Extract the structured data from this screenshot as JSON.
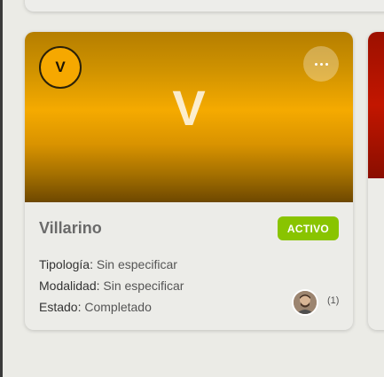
{
  "card": {
    "initial": "V",
    "banner_letter": "V",
    "name": "Villarino",
    "status": "ACTIVO",
    "fields": [
      {
        "label": "Tipología:",
        "value": "Sin especificar"
      },
      {
        "label": "Modalidad:",
        "value": "Sin especificar"
      },
      {
        "label": "Estado:",
        "value": "Completado"
      }
    ],
    "members_count": "(1)",
    "icons": {
      "menu": "more-horizontal-icon",
      "avatar": "user-avatar"
    }
  },
  "colors": {
    "banner": "#f5aa00",
    "status": "#89c400",
    "next_banner": "#c21600"
  }
}
